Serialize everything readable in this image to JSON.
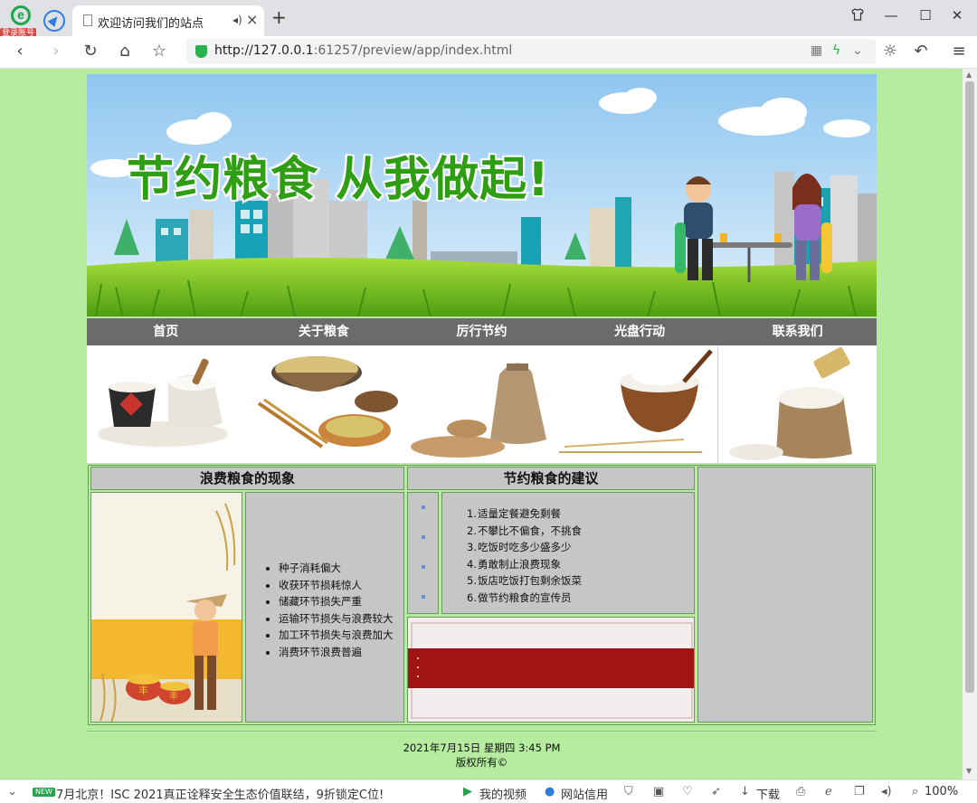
{
  "browser": {
    "login_badge": "登录账号",
    "tab_title": "欢迎访问我们的站点",
    "url_host": "http://127.0.0.1",
    "url_rest": ":61257/preview/app/index.html"
  },
  "page": {
    "banner_title": "节约粮食 从我做起!",
    "nav": [
      "首页",
      "关于粮食",
      "厉行节约",
      "光盘行动",
      "联系我们"
    ],
    "waste_heading": "浪费粮食的现象",
    "advice_heading": "节约粮食的建议",
    "waste_items": [
      "种子消耗偏大",
      "收获环节损耗惊人",
      "储藏环节损失严重",
      "运输环节损失与浪费较大",
      "加工环节损失与浪费加大",
      "消费环节浪费普遍"
    ],
    "advice_items": [
      {
        "num": "1.",
        "text": "适量定餐避免剩餐"
      },
      {
        "num": "2.",
        "text": "不攀比不偏食，不挑食"
      },
      {
        "num": "3.",
        "text": "吃饭时吃多少盛多少"
      },
      {
        "num": "4.",
        "text": "勇敢制止浪费现象"
      },
      {
        "num": "5.",
        "text": "饭店吃饭打包剩余饭菜"
      },
      {
        "num": "6.",
        "text": "做节约粮食的宣传员"
      }
    ],
    "poster_chars": [
      "丰",
      "丰"
    ],
    "footer_date": "2021年7月15日 星期四 3:45 PM",
    "footer_copyright": "版权所有©"
  },
  "statusbar": {
    "new_badge": "NEW",
    "news": "7月北京！ISC 2021真正诠释安全生态价值联结，9折锁定C位!",
    "my_video": "我的视频",
    "site_credit": "网站信用",
    "download": "下载",
    "zoom": "100%"
  },
  "colors": {
    "page_background": "#b5eca0",
    "nav_background": "#6b6b6b",
    "cell_background": "#c6c6c6",
    "banner_title": "#2f9e14",
    "red_band": "#a11416"
  }
}
